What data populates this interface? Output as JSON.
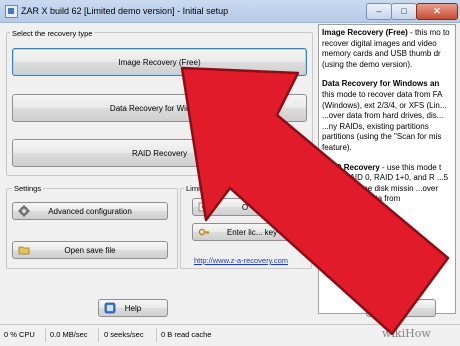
{
  "window": {
    "title": "ZAR X build 62 [Limited demo version] - Initial setup",
    "controls": {
      "minimize": "–",
      "maximize": "□",
      "close": "✕"
    }
  },
  "recovery_type": {
    "label": "Select the recovery type",
    "buttons": [
      {
        "label": "Image Recovery (Free)"
      },
      {
        "label": "Data Recovery for Windows"
      },
      {
        "label": "RAID Recovery"
      }
    ]
  },
  "settings": {
    "label": "Settings",
    "advanced_label": "Advanced configuration",
    "open_save_label": "Open save file"
  },
  "limited": {
    "label": "Limited dem",
    "order_label": "O",
    "enter_key_label": "Enter lic... key"
  },
  "link_text": "http://www.z-a-recovery.com",
  "help_label": "Help",
  "exit_label": "Exit",
  "description": {
    "p1_title": "Image Recovery (Free)",
    "p1_body": " - this mo to recover digital images and video memory cards and USB thumb dr (using the demo version).",
    "p2_title": "Data Recovery for Windows an",
    "p2_body": " this mode to recover data from FA (Windows), ext 2/3/4, or XFS (Lin... ...over data from hard drives, dis... ...ny RAIDs, existing partitions partitions (using the \"Scan for mis feature).",
    "p3_title": "RAID Recovery",
    "p3_body": " - use this mode t ...ken RAID 0, RAID 1+0, and R ...5 array with one disk missin ...over and recover data from"
  },
  "status": {
    "cpu": "0 % CPU",
    "read": "0.0 MB/sec",
    "seeks": "0 seeks/sec",
    "cache": "0 B read cache"
  },
  "watermark": "wikiHow",
  "colors": {
    "arrow": "#e21b2a",
    "link": "#1b39d6"
  },
  "icons": [
    "app-icon",
    "gear-icon",
    "folder-icon",
    "cart-icon",
    "key-icon",
    "help-icon",
    "exit-icon",
    "pointer-arrow"
  ]
}
